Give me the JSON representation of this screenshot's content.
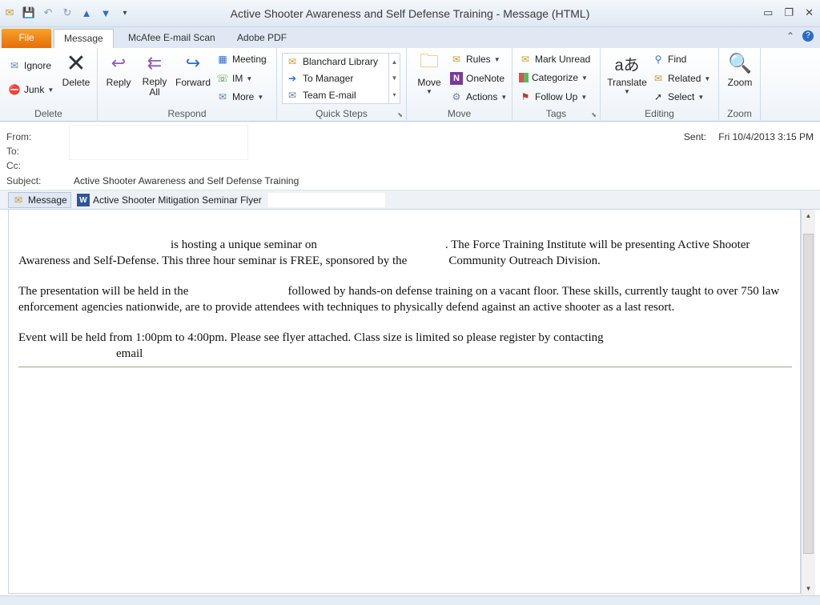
{
  "window": {
    "title": "Active Shooter Awareness and Self Defense Training  -  Message (HTML)"
  },
  "tabs": {
    "file": "File",
    "message": "Message",
    "mcafee": "McAfee E-mail Scan",
    "adobe": "Adobe PDF"
  },
  "ribbon": {
    "delete": {
      "ignore": "Ignore",
      "junk": "Junk",
      "delete": "Delete",
      "label": "Delete"
    },
    "respond": {
      "reply": "Reply",
      "reply_all": "Reply\nAll",
      "forward": "Forward",
      "meeting": "Meeting",
      "im": "IM",
      "more": "More",
      "label": "Respond"
    },
    "quick_steps": {
      "items": [
        "Blanchard Library",
        "To Manager",
        "Team E-mail"
      ],
      "label": "Quick Steps"
    },
    "move": {
      "move": "Move",
      "rules": "Rules",
      "onenote": "OneNote",
      "actions": "Actions",
      "label": "Move"
    },
    "tags": {
      "mark_unread": "Mark Unread",
      "categorize": "Categorize",
      "follow_up": "Follow Up",
      "label": "Tags"
    },
    "editing": {
      "translate": "Translate",
      "find": "Find",
      "related": "Related",
      "select": "Select",
      "label": "Editing"
    },
    "zoom": {
      "zoom": "Zoom",
      "label": "Zoom"
    }
  },
  "header": {
    "from_label": "From:",
    "to_label": "To:",
    "cc_label": "Cc:",
    "subject_label": "Subject:",
    "subject": "Active Shooter Awareness and Self Defense Training",
    "sent_label": "Sent:",
    "sent_value": "Fri 10/4/2013 3:15 PM"
  },
  "attachments": {
    "message_tab": "Message",
    "flyer": "Active Shooter Mitigation Seminar Flyer"
  },
  "body": {
    "p1a": "is hosting a unique seminar on",
    "p1b": ". The Force Training Institute will be presenting Active Shooter Awareness and Self-Defense. This three hour seminar is FREE, sponsored by the",
    "p1c": "Community Outreach Division.",
    "p2a": "The presentation will be held in the",
    "p2b": "followed by hands-on defense training on a vacant floor. These skills, currently taught to over 750 law enforcement agencies nationwide, are to provide attendees with techniques to physically defend against an active shooter as a last resort.",
    "p3a": "Event will be held from 1:00pm to 4:00pm. Please see flyer attached. Class size is limited so please register by contacting",
    "p3b": "email"
  }
}
